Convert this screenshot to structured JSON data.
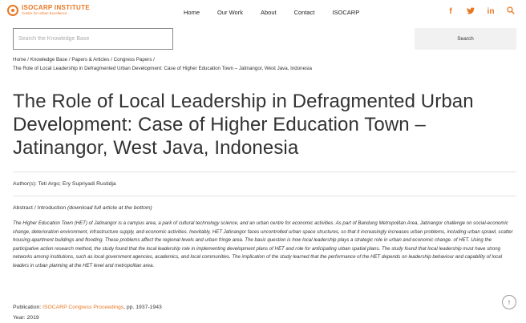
{
  "header": {
    "logo_name": "ISOCARP INSTITUTE",
    "logo_sub": "Centre for Urban Excellence",
    "nav": [
      "Home",
      "Our Work",
      "About",
      "Contact",
      "ISOCARP"
    ],
    "social_icons": [
      "facebook-icon",
      "twitter-icon",
      "linkedin-icon",
      "search-icon"
    ],
    "social_glyphs": [
      "f",
      "🐦",
      "in",
      "⌕"
    ],
    "accent_color": "#e87722"
  },
  "search": {
    "placeholder": "Search the Knowledge Base",
    "button_label": "Search"
  },
  "breadcrumb": {
    "items": [
      "Home",
      "Knowledge Base",
      "Papers & Articles",
      "Congress Papers"
    ],
    "current": "The Role of Local Leadership in Defragmented Urban Development: Case of Higher Education Town – Jatinangor, West Java, Indonesia"
  },
  "article": {
    "title": "The Role of Local Leadership in Defragmented Urban Development: Case of Higher Education Town – Jatinangor, West Java, Indonesia",
    "authors": "Author(s): Teti Argo; Ery Supriyadi Rustidja",
    "abstract_label": "Abstract / Introduction",
    "abstract_note": "(download full article at the bottom)",
    "abstract": "The Higher Education Town (HET) of Jatinangor is a campus area, a park of cultural technology science, and an urban centre for economic activities. As part of Bandung Metropolitan Area, Jatinangor challenge on social-economic change, deterioration environment, infrastructure supply, and economic activities. Inevitably, HET Jatinangor faces uncontrolled urban space structures, so that it increasingly increases urban problems, including urban sprawl, scatter housing-apartment buildings and flooding. These problems affect the regional levels and urban fringe area. The basic question is how local leadership plays a strategic role in urban and economic change. of HET. Using the participative action research method, the study found that the local leadership role in implementing development plans of HET and role for anticipating urban spatial plans. The study found that local leadership must have strong networks among institutions, such as local government agencies, academics, and local communities. The implication of the study learned that the performance of the HET depends on leadership behaviour and capability of local leaders in urban planning at the HET level and metropolitan area.",
    "publication_label": "Publication:",
    "publication_link": "ISOCARP Congress Proceedings",
    "publication_pages": ", pp. 1937-1943",
    "year": "Year: 2019"
  },
  "back_to_top": "↑"
}
